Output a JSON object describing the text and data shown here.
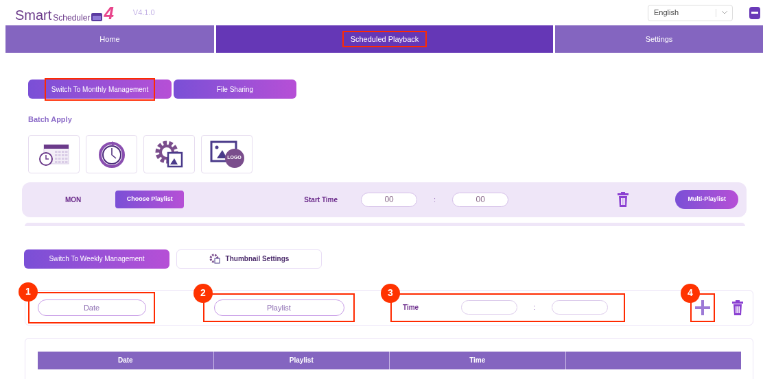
{
  "header": {
    "logo": {
      "word": "Smart",
      "sub": "Scheduler",
      "number": "4"
    },
    "version": "V4.1.0",
    "language": "English"
  },
  "nav": [
    {
      "label": "Home",
      "selected": false,
      "highlighted": false
    },
    {
      "label": "Scheduled Playback",
      "selected": true,
      "highlighted": true
    },
    {
      "label": "Settings",
      "selected": false,
      "highlighted": false
    }
  ],
  "top_buttons": [
    {
      "label": "Switch To Monthly Management",
      "highlighted": true
    },
    {
      "label": "File Sharing",
      "highlighted": false
    }
  ],
  "batch_apply": {
    "title": "Batch Apply",
    "tools": [
      {
        "kind": "calendar"
      },
      {
        "kind": "clock"
      },
      {
        "kind": "gear"
      },
      {
        "kind": "logo",
        "text": "LOGO"
      }
    ]
  },
  "day_row": {
    "day": "MON",
    "choose": "Choose Playlist",
    "start_label": "Start Time",
    "hour": "00",
    "separator": ":",
    "minute": "00",
    "multi": "Multi-Playlist"
  },
  "lower_buttons": [
    {
      "label": "Switch To Weekly Management",
      "kind": "primary"
    },
    {
      "label": "Thumbnail Settings",
      "kind": "outline"
    }
  ],
  "entry_form": {
    "date": {
      "placeholder": "Date",
      "callout": "1"
    },
    "playlist": {
      "placeholder": "Playlist",
      "callout": "2"
    },
    "time": {
      "label": "Time",
      "separator": ":",
      "callout": "3"
    },
    "add": {
      "callout": "4"
    }
  },
  "table": {
    "columns": [
      "Date",
      "Playlist",
      "Time",
      ""
    ]
  }
}
